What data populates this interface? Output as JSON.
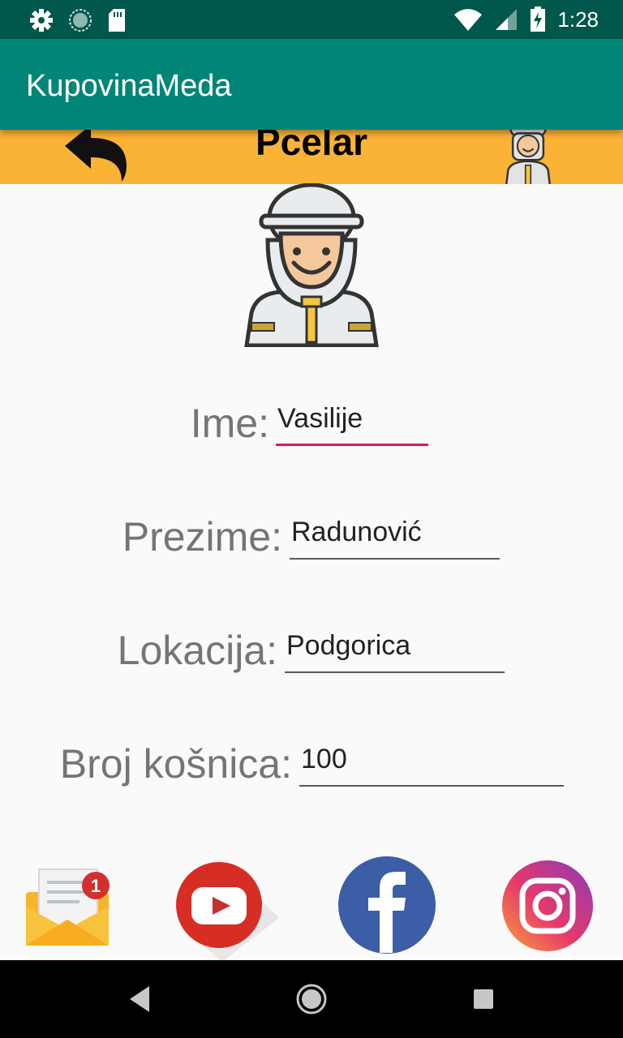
{
  "status_bar": {
    "time": "1:28",
    "icons": [
      "settings-icon",
      "sync-icon",
      "sd-card-icon",
      "wifi-icon",
      "signal-icon",
      "battery-charging-icon"
    ]
  },
  "app_bar": {
    "title": "KupovinaMeda"
  },
  "header": {
    "title": "Pcelar",
    "back_icon": "back-arrow-icon",
    "avatar_icon": "beekeeper-icon"
  },
  "profile": {
    "avatar_icon": "beekeeper-icon"
  },
  "form": {
    "ime_label": "Ime:",
    "ime_value": "Vasilije",
    "prezime_label": "Prezime:",
    "prezime_value": "Radunović",
    "lokacija_label": "Lokacija:",
    "lokacija_value": "Podgorica",
    "broj_label": "Broj košnica:",
    "broj_value": "100"
  },
  "social": {
    "icons": [
      "email-icon",
      "youtube-icon",
      "facebook-icon",
      "instagram-icon"
    ],
    "email_badge": "1"
  },
  "nav": {
    "icons": [
      "back-triangle-icon",
      "home-circle-icon",
      "recents-square-icon"
    ]
  },
  "colors": {
    "status_bar": "#00574b",
    "app_bar": "#008577",
    "header_strip": "#fbb335",
    "accent": "#d81b60"
  }
}
